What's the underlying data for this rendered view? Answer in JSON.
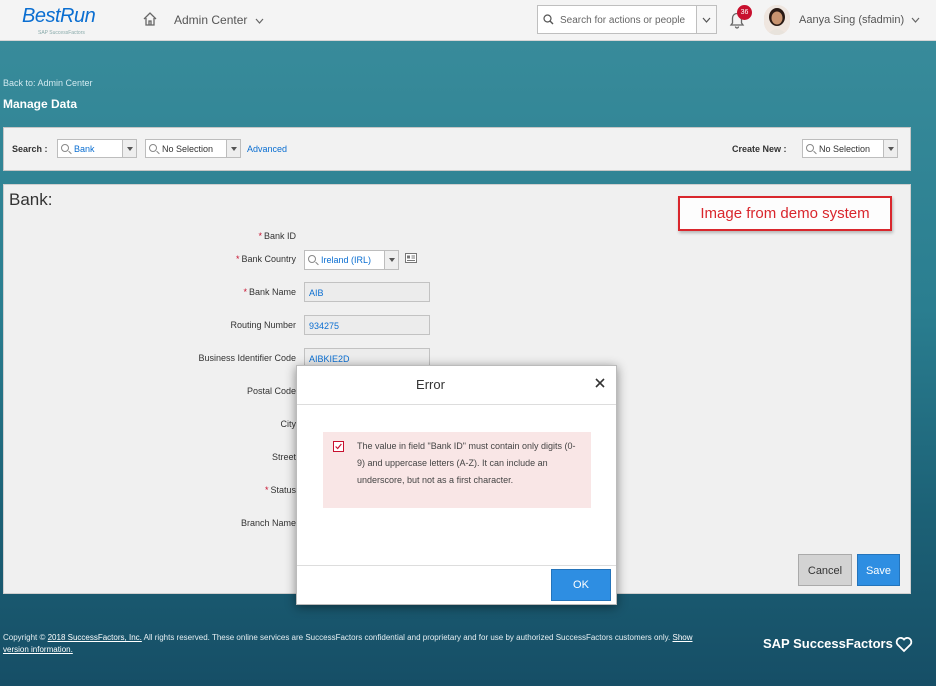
{
  "header": {
    "logo": "BestRun",
    "logo_sub": "SAP SuccessFactors",
    "admin_menu": "Admin Center",
    "search_placeholder": "Search for actions or people",
    "notification_count": "36",
    "user_name": "Aanya Sing (sfadmin)"
  },
  "page": {
    "back_link": "Back to: Admin Center",
    "title": "Manage Data"
  },
  "search_bar": {
    "search_label": "Search :",
    "search_type": "Bank",
    "selection": "No Selection",
    "advanced": "Advanced",
    "create_label": "Create New :",
    "create_selection": "No Selection"
  },
  "form": {
    "title": "Bank:",
    "fields": [
      {
        "label": "Bank ID",
        "required": "*",
        "value": ""
      },
      {
        "label": "Bank Country",
        "required": "*",
        "value": "Ireland (IRL)"
      },
      {
        "label": "Bank Name",
        "required": "*",
        "value": "AIB"
      },
      {
        "label": "Routing Number",
        "required": "",
        "value": "934275"
      },
      {
        "label": "Business Identifier Code",
        "required": "",
        "value": "AIBKIE2D"
      },
      {
        "label": "Postal Code",
        "required": "",
        "value": ""
      },
      {
        "label": "City",
        "required": "",
        "value": ""
      },
      {
        "label": "Street",
        "required": "",
        "value": ""
      },
      {
        "label": "Status",
        "required": "*",
        "value": ""
      },
      {
        "label": "Branch Name",
        "required": "",
        "value": ""
      }
    ],
    "cancel_label": "Cancel",
    "save_label": "Save"
  },
  "note": "Image from demo system",
  "dialog": {
    "title": "Error",
    "message": "The value in field \"Bank ID\" must contain only digits (0-9) and uppercase letters (A-Z). It can include an underscore, but not as a first character.",
    "ok_label": "OK"
  },
  "footer": {
    "copyright_prefix": "Copyright ©",
    "copyright_link": "2018 SuccessFactors, Inc.",
    "copyright_text": "All rights reserved. These online services are SuccessFactors confidential and proprietary and for use by authorized SuccessFactors customers only.",
    "version_link": "Show version information.",
    "brand": "SAP SuccessFactors"
  },
  "colors": {
    "accent": "#2e8ee2",
    "error": "#c8102e",
    "note_red": "#d9262c"
  }
}
